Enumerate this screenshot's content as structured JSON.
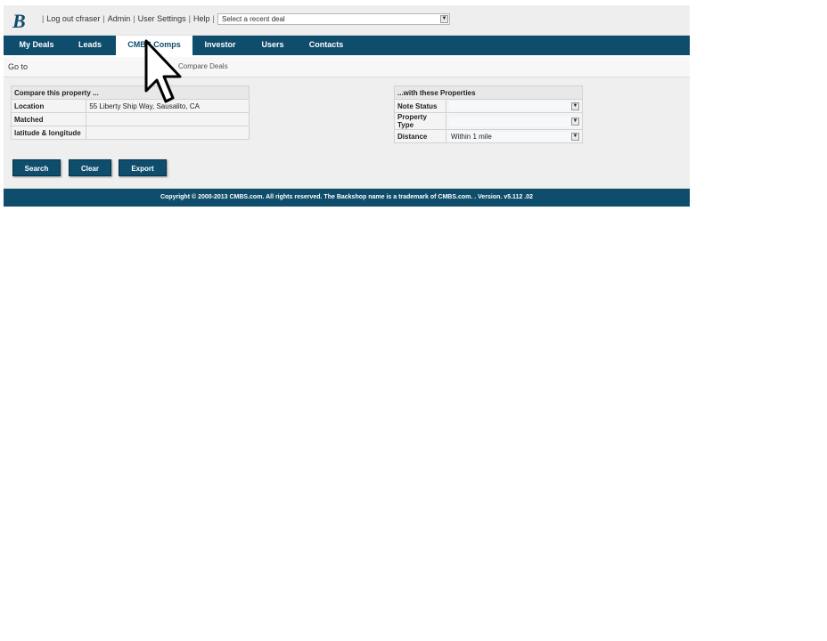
{
  "header": {
    "logo_letter": "B",
    "links": [
      "Log out cfraser",
      "Admin",
      "User Settings",
      "Help"
    ],
    "recent_deal_placeholder": "Select a recent deal"
  },
  "nav": {
    "tabs": [
      "My Deals",
      "Leads",
      "CMBS Comps",
      "Investor",
      "Users",
      "Contacts"
    ],
    "active_tab": "CMBS Comps"
  },
  "subnav": {
    "goto_label": "Go to",
    "subtab": "Compare Deals"
  },
  "compare_property": {
    "title": "Compare this property ...",
    "rows": [
      {
        "label": "Location",
        "value": "55 Liberty Ship Way, Sausalito, CA"
      },
      {
        "label": "Matched",
        "value": ""
      },
      {
        "label": "latitude & longitude",
        "value": ""
      }
    ]
  },
  "with_properties": {
    "title": "...with these Properties",
    "rows": [
      {
        "label": "Note Status",
        "value": ""
      },
      {
        "label": "Property Type",
        "value": ""
      },
      {
        "label": "Distance",
        "value": "Within 1 mile"
      }
    ]
  },
  "buttons": {
    "search": "Search",
    "clear": "Clear",
    "export": "Export"
  },
  "footer": {
    "text": "Copyright © 2000-2013 CMBS.com. All rights reserved. The Backshop name is a trademark of CMBS.com. . Version. v5.112 .02"
  },
  "colors": {
    "brand": "#0f4d6c",
    "panel_bg": "#efefef"
  },
  "icons": {
    "dropdown": "chevron-down-icon",
    "cursor": "mouse-pointer-icon"
  }
}
